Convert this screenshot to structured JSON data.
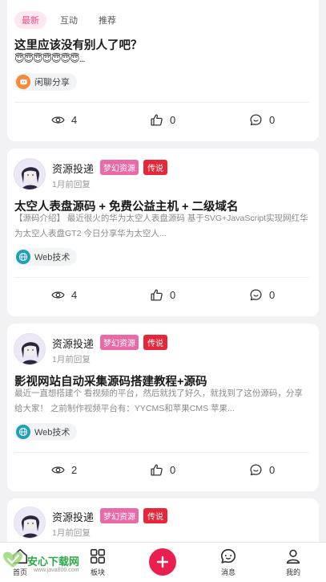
{
  "filter_tabs": [
    {
      "label": "最新",
      "active": true
    },
    {
      "label": "互动",
      "active": false
    },
    {
      "label": "推荐",
      "active": false
    }
  ],
  "posts": [
    {
      "title": "这里应该没有别人了吧？",
      "emoji_line": "😇😇😇😇😇😇😇...",
      "topic": "闲聊分享",
      "topic_icon": "chat-bubble-icon",
      "views": "4",
      "likes": "0",
      "comments": "0"
    },
    {
      "author": "资源投递",
      "badge_level": "梦幻资源",
      "badge_rank": "传说",
      "time": "1月前回复",
      "title": "太空人表盘源码 + 免费公益主机 + 二级域名",
      "desc": "【源码介绍】 最近很火的华为太空人表盘源码 基于SVG+JavaScript实现网红华为太空人表盘GT2 今日分享华为太空人...",
      "topic": "Web技术",
      "topic_icon": "globe-icon",
      "views": "4",
      "likes": "0",
      "comments": "0"
    },
    {
      "author": "资源投递",
      "badge_level": "梦幻资源",
      "badge_rank": "传说",
      "time": "1月前回复",
      "title": "影视网站自动采集源码搭建教程+源码",
      "desc": "最近一直想搭建个 看视频的平台，然后就找了好久，就找到了这份源码，分享给大家！ 之前制作视频平台有：YYCMS和苹果CMS 苹果...",
      "topic": "Web技术",
      "topic_icon": "globe-icon",
      "views": "2",
      "likes": "0",
      "comments": "0"
    },
    {
      "author": "资源投递",
      "badge_level": "梦幻资源",
      "badge_rank": "传说",
      "time": "1月前回复"
    }
  ],
  "bottom_nav": {
    "home": "首页",
    "block": "板块",
    "message": "消息",
    "mine": "我的"
  },
  "watermark": {
    "title": "安心下载网",
    "url": "www.java800.com"
  },
  "colors": {
    "accent_pink": "#ea4c89",
    "add_button": "#ea1f4f",
    "badge_red": "#e8263a"
  }
}
